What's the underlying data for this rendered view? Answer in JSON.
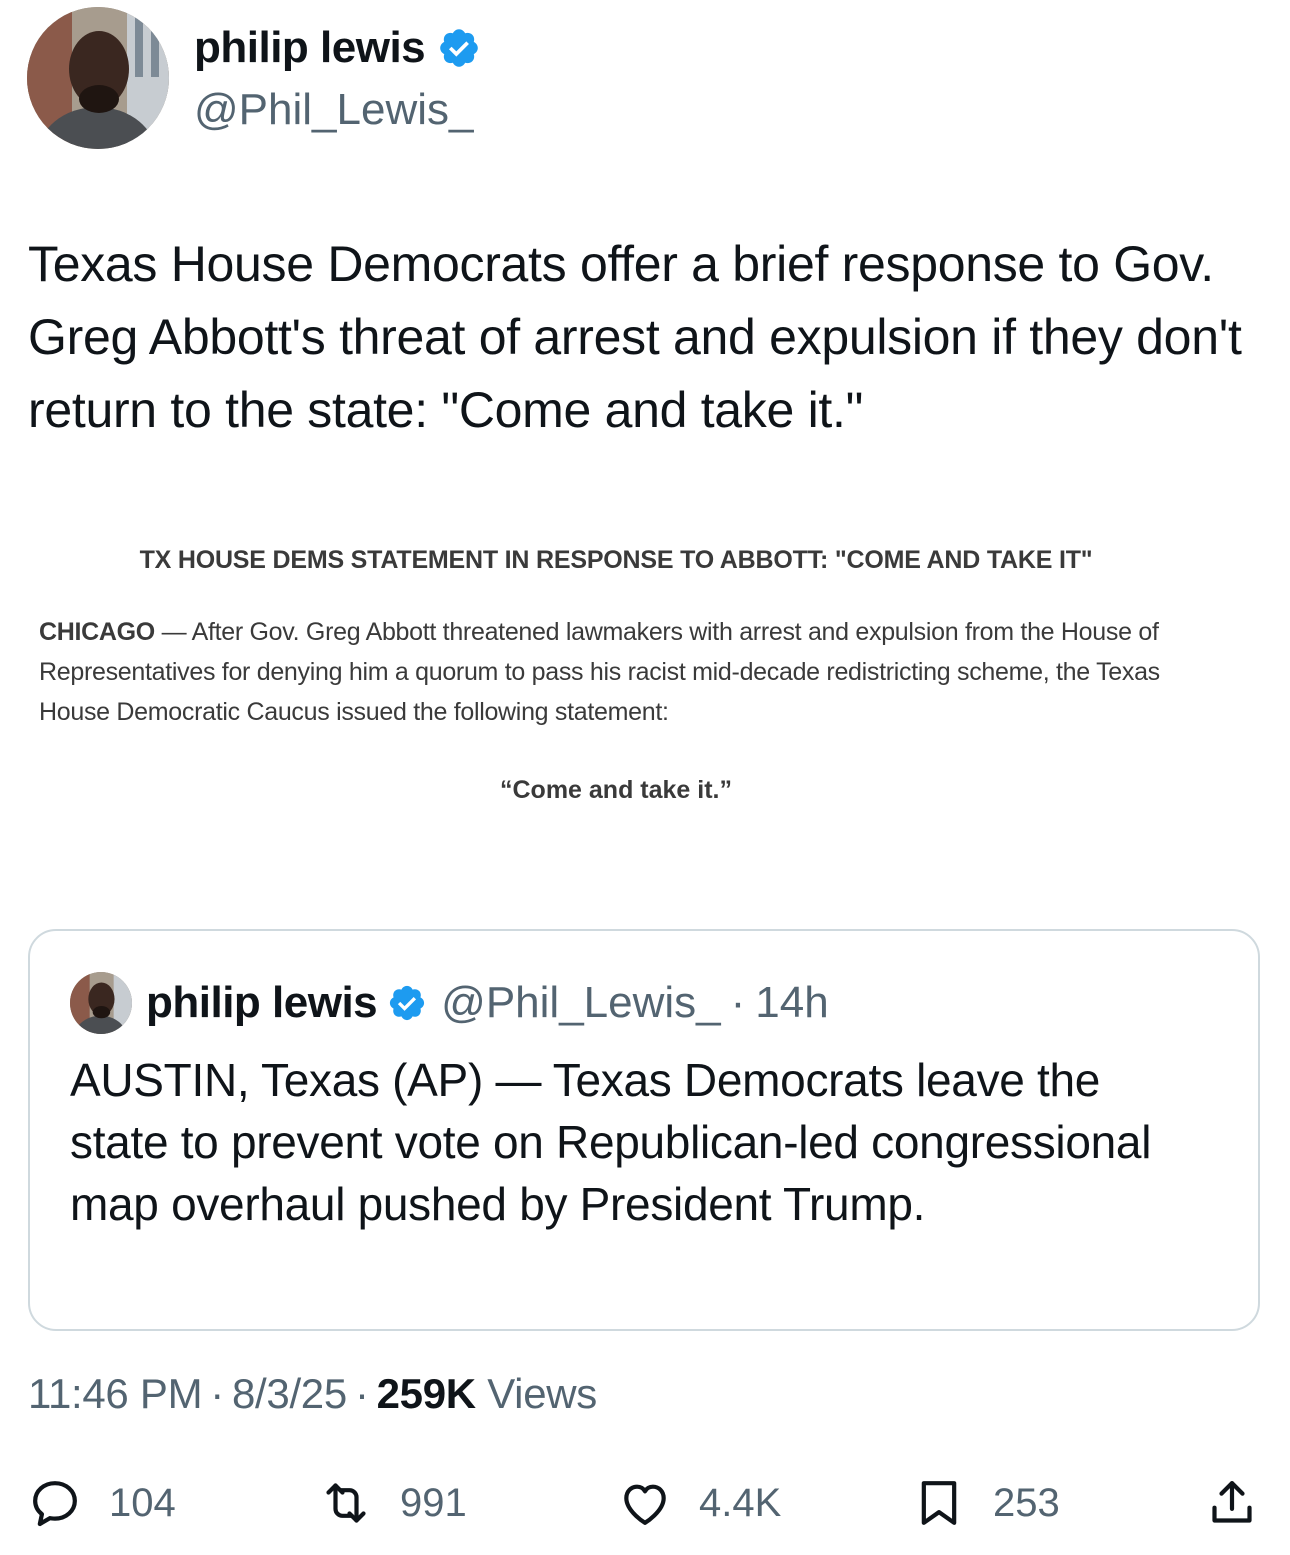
{
  "author": {
    "name": "philip lewis",
    "handle": "@Phil_Lewis_"
  },
  "tweet": {
    "text": "Texas House Democrats offer a brief response to Gov. Greg Abbott's threat of arrest and expulsion if they don't return to the state: \"Come and take it.\""
  },
  "statement_image": {
    "title": "TX HOUSE DEMS STATEMENT IN RESPONSE TO ABBOTT: \"COME AND TAKE IT\"",
    "dateline": "CHICAGO",
    "body": "— After Gov. Greg Abbott threatened lawmakers with arrest and expulsion from the House of Representatives for denying him a quorum to pass his racist mid-decade redistricting scheme, the Texas House Democratic Caucus issued the following statement:",
    "quote": "“Come and take it.”"
  },
  "quoted_tweet": {
    "name": "philip lewis",
    "handle": "@Phil_Lewis_",
    "dot": "·",
    "time": "14h",
    "text": "AUSTIN, Texas (AP) — Texas Democrats leave the state to prevent vote on Republican-led congressional map overhaul pushed by President Trump."
  },
  "meta": {
    "time": "11:46 PM",
    "sep": "·",
    "date": "8/3/25",
    "views_count": "259K",
    "views_label": "Views"
  },
  "actions": {
    "replies": "104",
    "reposts": "991",
    "likes": "4.4K",
    "bookmarks": "253"
  },
  "colors": {
    "verified": "#1d9bf0",
    "text": "#0f1419",
    "secondary": "#536471",
    "border": "#cfd9de"
  }
}
